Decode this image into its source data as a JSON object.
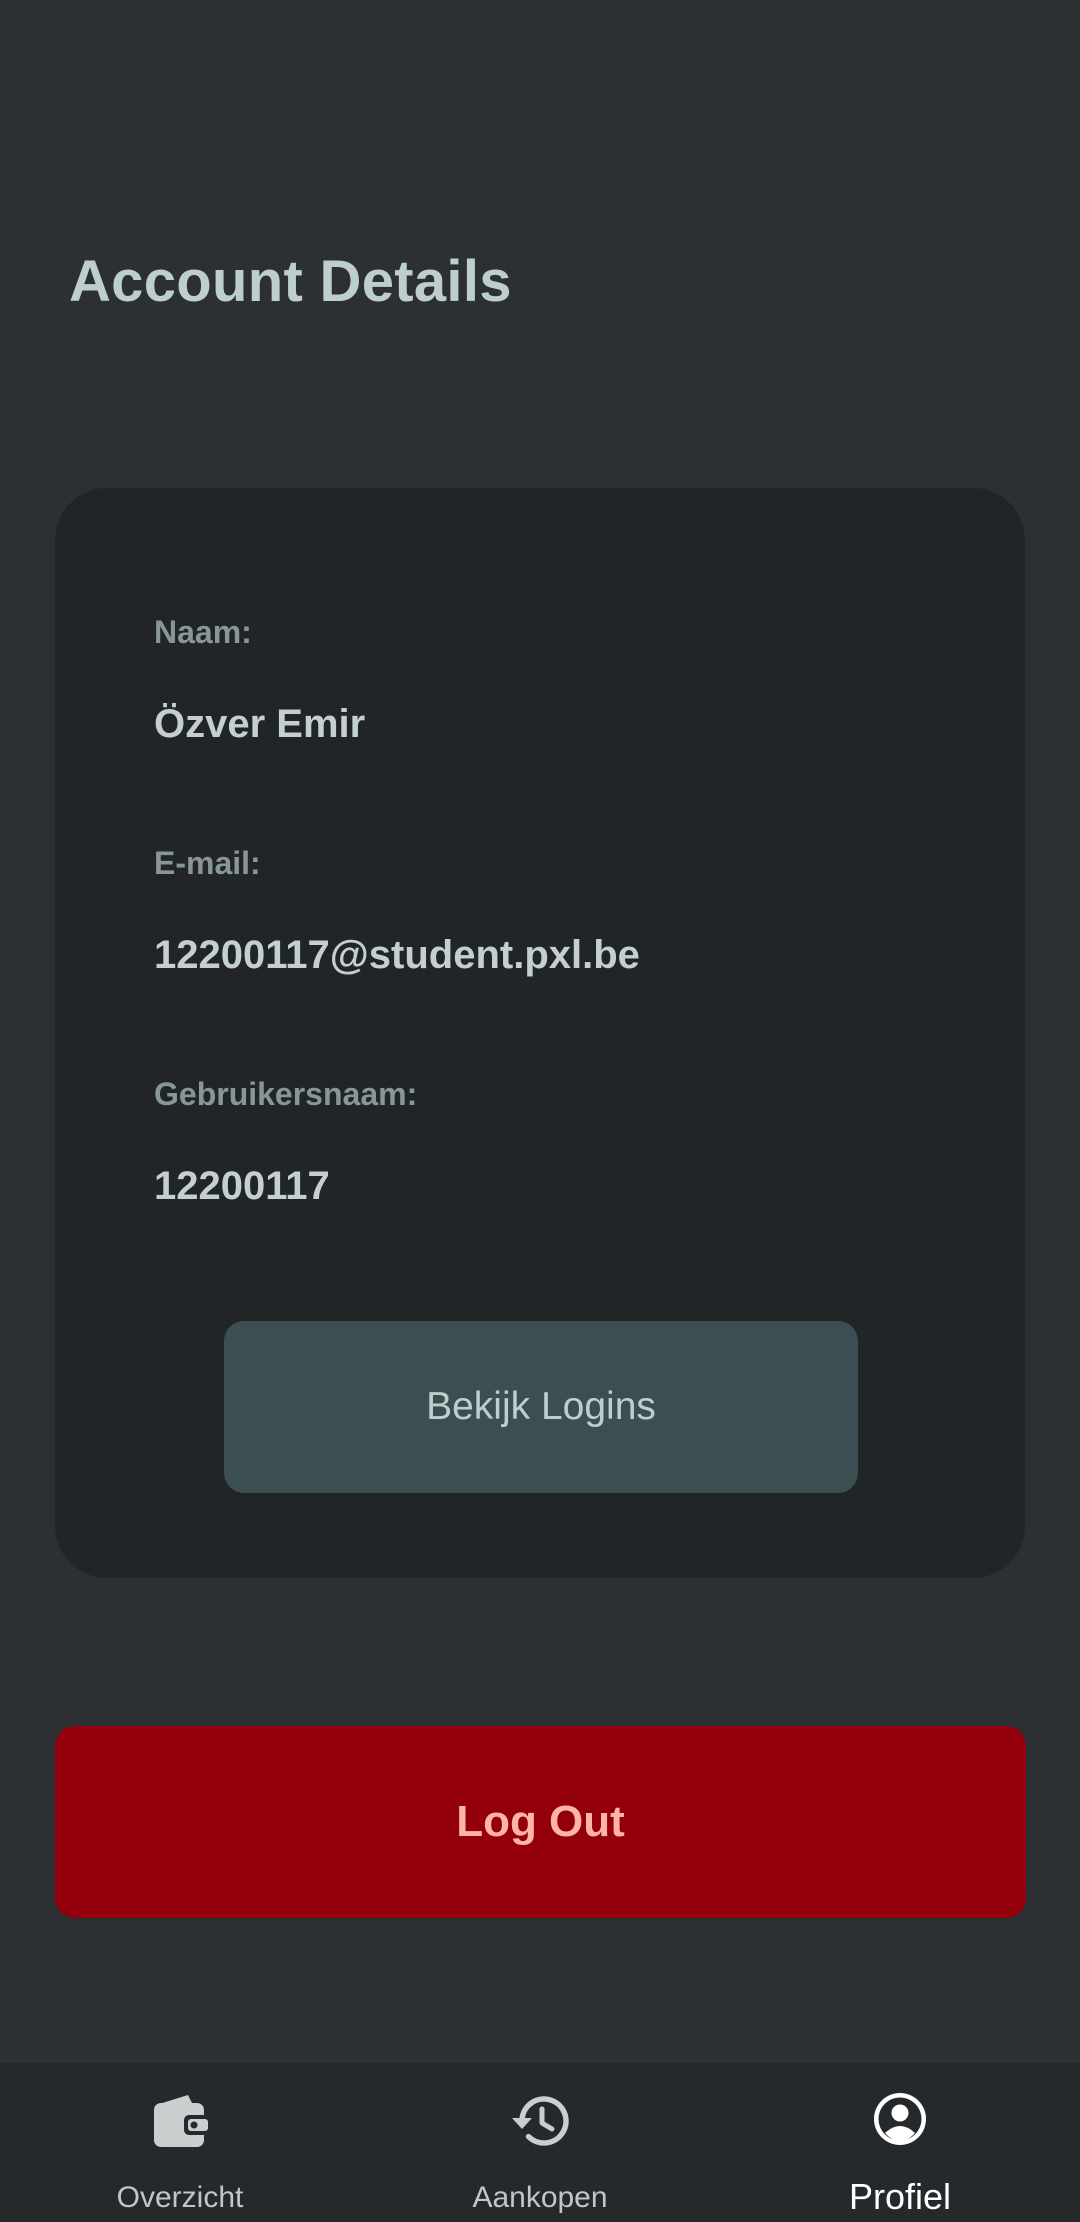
{
  "page": {
    "title": "Account Details"
  },
  "account": {
    "name_label": "Naam:",
    "name_value": "Özver Emir",
    "email_label": "E-mail:",
    "email_value": "12200117@student.pxl.be",
    "username_label": "Gebruikersnaam:",
    "username_value": "12200117",
    "logins_button_label": "Bekijk Logins"
  },
  "logout": {
    "label": "Log Out"
  },
  "nav": {
    "items": [
      {
        "label": "Overzicht",
        "icon": "wallet-icon",
        "active": false
      },
      {
        "label": "Aankopen",
        "icon": "history-icon",
        "active": false
      },
      {
        "label": "Profiel",
        "icon": "account-circle-icon",
        "active": true
      }
    ]
  },
  "colors": {
    "background": "#2c3032",
    "card": "#222527",
    "title": "#bccfcc",
    "label": "#899794",
    "value": "#c3d0ce",
    "secondary_button": "#3b4e51",
    "logout_bg": "#93000b",
    "logout_text": "#ffb4a8",
    "nav_bg": "#25292b"
  }
}
